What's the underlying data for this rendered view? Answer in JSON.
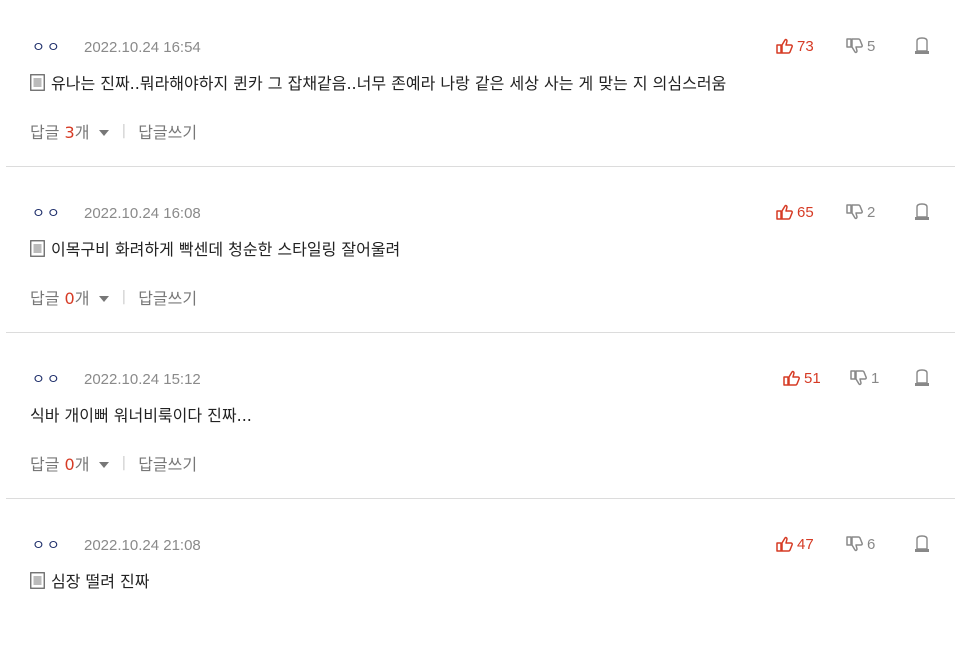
{
  "colors": {
    "accent_red": "#d63b25",
    "meta_gray": "#8a8a8a",
    "author_blue": "#1f2f6b",
    "divider": "#dcdcdc"
  },
  "icons": {
    "doc": "doc-icon",
    "like": "thumbs-up-icon",
    "dislike": "thumbs-down-icon",
    "report": "report-icon",
    "caret": "caret-down-icon"
  },
  "reply_label": "답글",
  "reply_count_suffix": "개",
  "write_reply_label": "답글쓰기",
  "separator": "|",
  "comments": [
    {
      "author": "ㅇㅇ",
      "date": "2022.10.24 16:54",
      "has_doc_icon": true,
      "text": "유나는 진짜..뭐라해야하지 퀸카 그 잡채같음..너무 존예라 나랑 같은 세상 사는 게 맞는 지 의심스러움",
      "likes": "73",
      "dislikes": "5",
      "reply_count": "3"
    },
    {
      "author": "ㅇㅇ",
      "date": "2022.10.24 16:08",
      "has_doc_icon": true,
      "text": "이목구비 화려하게 빡센데 청순한 스타일링 잘어울려",
      "likes": "65",
      "dislikes": "2",
      "reply_count": "0"
    },
    {
      "author": "ㅇㅇ",
      "date": "2022.10.24 15:12",
      "has_doc_icon": false,
      "text": "식바 개이뻐 워너비룩이다 진짜...",
      "likes": "51",
      "dislikes": "1",
      "reply_count": "0"
    },
    {
      "author": "ㅇㅇ",
      "date": "2022.10.24 21:08",
      "has_doc_icon": true,
      "text": "심장 떨려 진짜",
      "likes": "47",
      "dislikes": "6",
      "reply_count": ""
    }
  ]
}
